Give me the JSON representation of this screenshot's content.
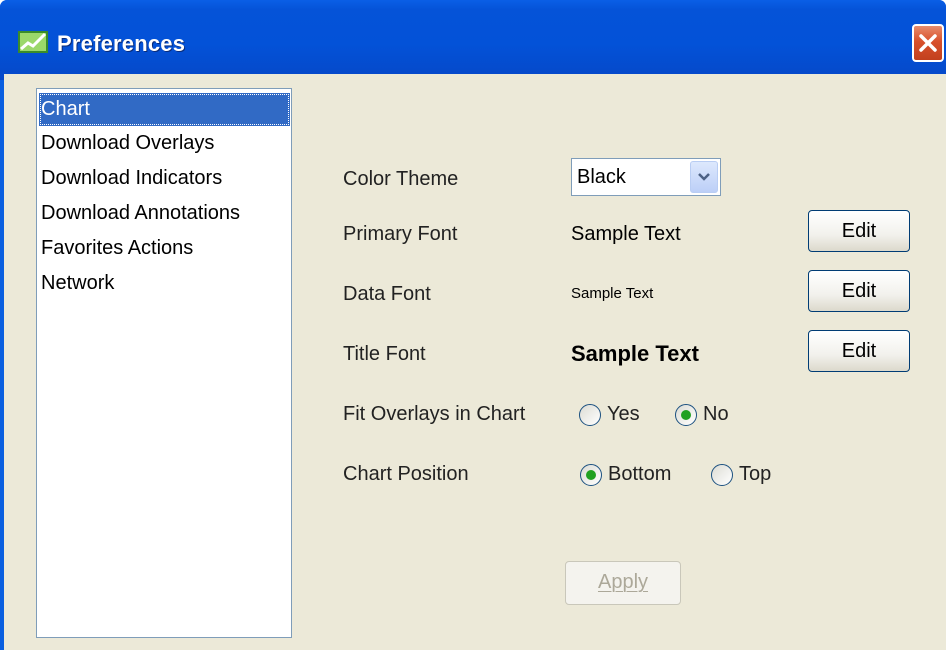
{
  "window": {
    "title": "Preferences"
  },
  "sidebar": {
    "items": [
      {
        "label": "Chart",
        "selected": true
      },
      {
        "label": "Download Overlays",
        "selected": false
      },
      {
        "label": "Download Indicators",
        "selected": false
      },
      {
        "label": "Download Annotations",
        "selected": false
      },
      {
        "label": "Favorites Actions",
        "selected": false
      },
      {
        "label": "Network",
        "selected": false
      }
    ]
  },
  "settings": {
    "color_theme": {
      "label": "Color Theme",
      "value": "Black"
    },
    "primary_font": {
      "label": "Primary Font",
      "sample": "Sample Text",
      "button": "Edit"
    },
    "data_font": {
      "label": "Data Font",
      "sample": "Sample Text",
      "button": "Edit"
    },
    "title_font": {
      "label": "Title Font",
      "sample": "Sample Text",
      "button": "Edit"
    },
    "fit_overlays": {
      "label": "Fit Overlays in Chart",
      "options": [
        "Yes",
        "No"
      ],
      "selected": "No"
    },
    "chart_position": {
      "label": "Chart Position",
      "options": [
        "Bottom",
        "Top"
      ],
      "selected": "Bottom"
    }
  },
  "apply_button": {
    "label": "Apply",
    "enabled": false
  },
  "colors": {
    "titlebar": "#0352d8",
    "dialog_bg": "#ece9d8",
    "selection": "#316ac5",
    "radio_dot": "#21a121",
    "close_button": "#d8502c"
  },
  "icons": {
    "title": "chart-line-icon",
    "close": "close-icon",
    "dropdown": "chevron-down-icon"
  }
}
